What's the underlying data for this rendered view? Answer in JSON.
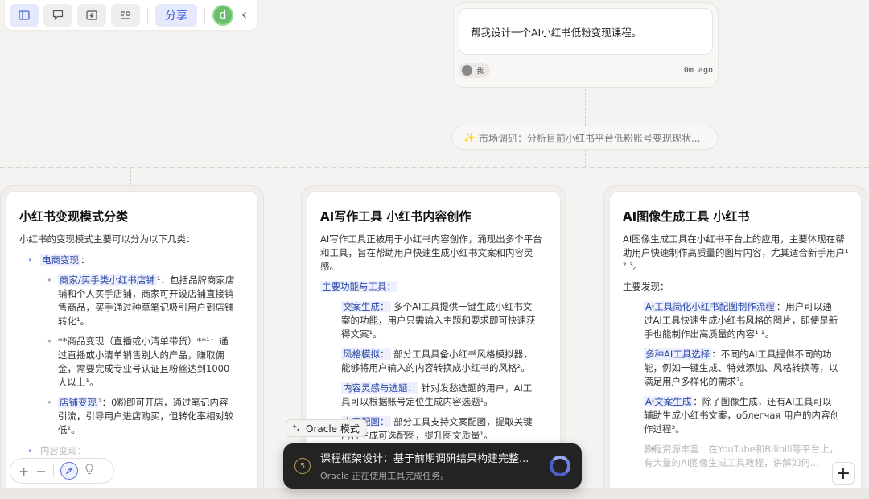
{
  "toolbar": {
    "icons": [
      "sidebar-icon",
      "chat-icon",
      "download-icon",
      "search-list-icon"
    ],
    "share_label": "分享",
    "avatar_letter": "d",
    "collapse_glyph": "‹"
  },
  "prompt": {
    "text": "帮我设计一个AI小红书低粉变现课程。",
    "author": "我",
    "time": "0m ago"
  },
  "research_step": {
    "text": "市场调研：分析目前小红书平台低粉账号变现现状..."
  },
  "cards": {
    "c1": {
      "title": "小红书变现模式分类",
      "intro": "小红书的变现模式主要可以分为以下几类：",
      "l1_label": "电商变现",
      "l1_colon": "：",
      "items": [
        {
          "label": "商家/买手类小红书店铺",
          "sup": "¹",
          "text": "：包括品牌商家店铺和个人买手店铺，商家可开设店铺直接销售商品，买手通过种草笔记吸引用户到店铺转化¹。"
        },
        {
          "label": "",
          "sup": "",
          "text": "**商品变现（直播或小清单带货）**¹：通过直播或小清单销售别人的产品，赚取佣金，需要完成专业号认证且粉丝达到1000人以上¹。"
        },
        {
          "label": "店铺变现",
          "sup": "²",
          "text": "：0粉即可开店，通过笔记内容引流，引导用户进店购买，但转化率相对较低²。"
        }
      ],
      "faded_label": "内容变现："
    },
    "c2": {
      "title": "AI写作工具 小红书内容创作",
      "intro": "AI写作工具正被用于小红书内容创作，涌现出多个平台和工具，旨在帮助用户快速生成小红书文案和内容灵感。",
      "section": "主要功能与工具：",
      "items": [
        {
          "label": "文案生成：",
          "text": "多个AI工具提供一键生成小红书文案的功能，用户只需输入主题和要求即可快速获得文案¹。"
        },
        {
          "label": "风格模拟：",
          "text": "部分工具具备小红书风格模拟器，能够将用户输入的内容转换成小红书的风格²。"
        },
        {
          "label": "内容灵感与选题：",
          "text": "针对发愁选题的用户，AI工具可以根据账号定位生成内容选题¹。"
        },
        {
          "label": "文案配图：",
          "text": "部分工具支持文案配图，提取关键内容生成可选配图，提升图文质量¹。"
        }
      ]
    },
    "c3": {
      "title": "AI图像生成工具 小红书",
      "intro": "AI图像生成工具在小红书平台上的应用，主要体现在帮助用户快速制作高质量的图片内容，尤其适合新手用户¹ ² ³。",
      "section": "主要发现：",
      "items": [
        {
          "label": "AI工具简化小红书配图制作流程",
          "text": "：用户可以通过AI工具快速生成小红书风格的图片，即使是新手也能制作出高质量的内容¹ ²。"
        },
        {
          "label": "多种AI工具选择",
          "text": "：不同的AI工具提供不同的功能，例如一键生成、特效添加、风格转换等，以满足用户多样化的需求²。"
        },
        {
          "label": "AI文案生成",
          "text": "：除了图像生成，还有AI工具可以辅助生成小红书文案，облегчая 用户的内容创作过程³。"
        },
        {
          "label": "教程资源丰富",
          "text": "：在YouTube和Bilibili等平台上，有大量的AI图像生成工具教程，讲解如何..."
        }
      ]
    }
  },
  "oracle_mode": {
    "label": "Oracle 模式"
  },
  "task": {
    "step": "5",
    "title": "课程框架设计：基于前期调研结果构建完整...",
    "status": "Oracle 正在使用工具完成任务。"
  },
  "zoom": {
    "plus": "+",
    "minus": "−"
  },
  "add_button": "+"
}
